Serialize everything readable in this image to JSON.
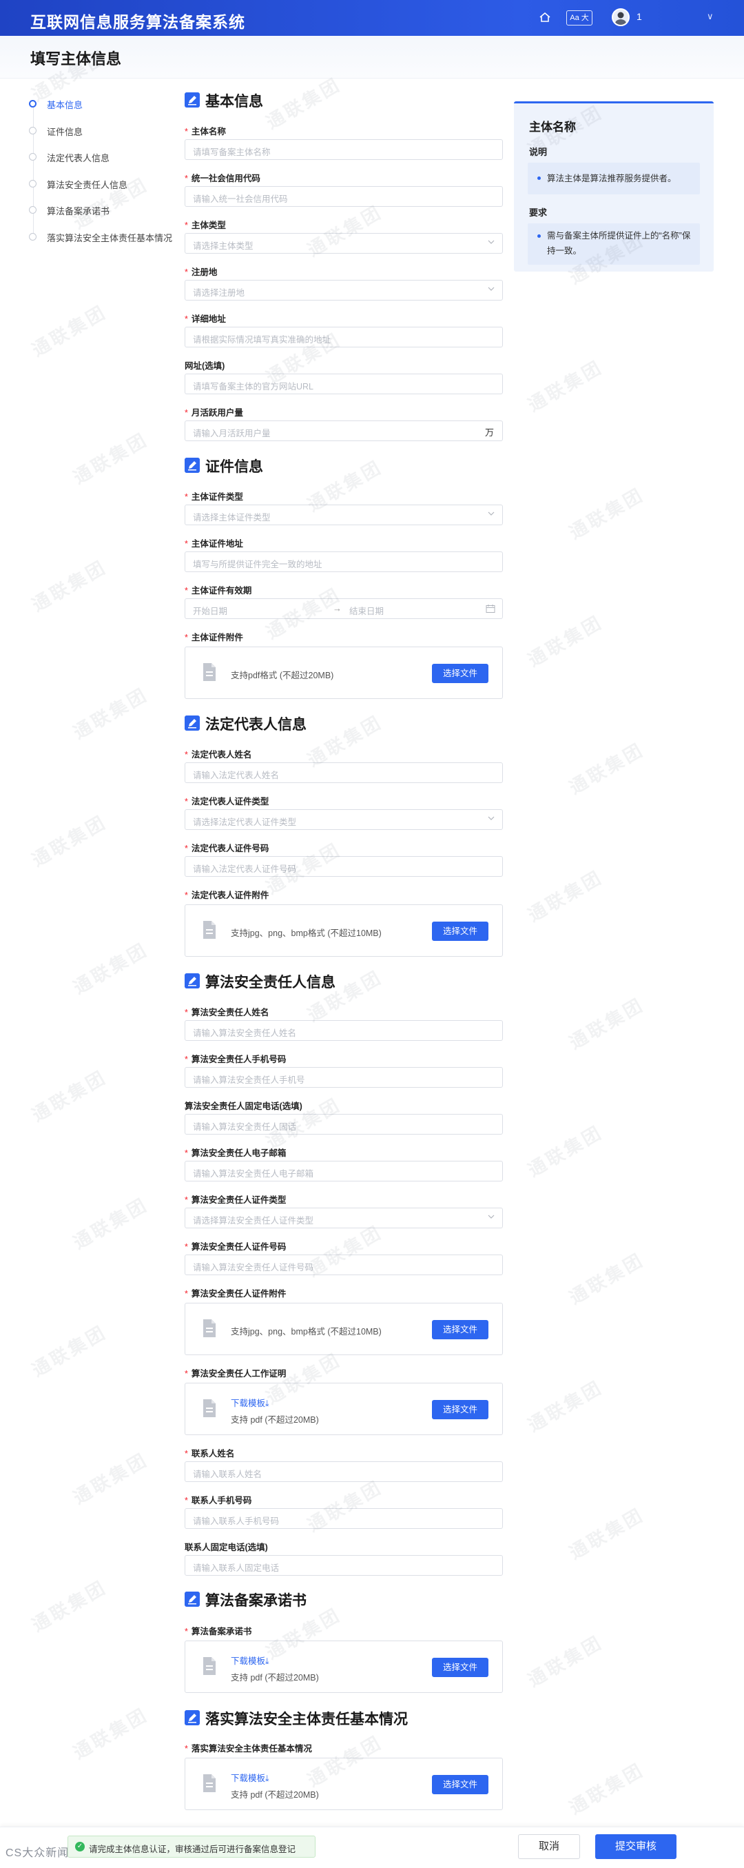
{
  "header": {
    "app_title": "互联网信息服务算法备案系统",
    "font_toggle": "Aa 大",
    "user_name": "1"
  },
  "page_title": "填写主体信息",
  "nav": {
    "items": [
      {
        "label": "基本信息",
        "active": true
      },
      {
        "label": "证件信息",
        "active": false
      },
      {
        "label": "法定代表人信息",
        "active": false
      },
      {
        "label": "算法安全责任人信息",
        "active": false
      },
      {
        "label": "算法备案承诺书",
        "active": false
      },
      {
        "label": "落实算法安全主体责任基本情况",
        "active": false
      }
    ]
  },
  "sections": {
    "basic": "基本信息",
    "cert": "证件信息",
    "legal": "法定代表人信息",
    "safety": "算法安全责任人信息",
    "promise": "算法备案承诺书",
    "duty": "落实算法安全主体责任基本情况"
  },
  "fields": {
    "subject_name": {
      "label": "主体名称",
      "placeholder": "请填写备案主体名称"
    },
    "credit_code": {
      "label": "统一社会信用代码",
      "placeholder": "请输入统一社会信用代码"
    },
    "subject_type": {
      "label": "主体类型",
      "placeholder": "请选择主体类型"
    },
    "region": {
      "label": "注册地",
      "placeholder": "请选择注册地"
    },
    "address": {
      "label": "详细地址",
      "placeholder": "请根据实际情况填写真实准确的地址"
    },
    "website": {
      "label": "网址(选填)",
      "placeholder": "请填写备案主体的官方网站URL"
    },
    "mau": {
      "label": "月活跃用户量",
      "placeholder": "请输入月活跃用户量",
      "suffix": "万"
    },
    "cert_type": {
      "label": "主体证件类型",
      "placeholder": "请选择主体证件类型"
    },
    "cert_address": {
      "label": "主体证件地址",
      "placeholder": "填写与所提供证件完全一致的地址"
    },
    "cert_validity": {
      "label": "主体证件有效期",
      "start_placeholder": "开始日期",
      "end_placeholder": "结束日期",
      "separator": "→"
    },
    "cert_attachment": {
      "label": "主体证件附件",
      "hint": "支持pdf格式 (不超过20MB)",
      "button": "选择文件"
    },
    "legal_name": {
      "label": "法定代表人姓名",
      "placeholder": "请输入法定代表人姓名"
    },
    "legal_id_type": {
      "label": "法定代表人证件类型",
      "placeholder": "请选择法定代表人证件类型"
    },
    "legal_id_no": {
      "label": "法定代表人证件号码",
      "placeholder": "请输入法定代表人证件号码"
    },
    "legal_attachment": {
      "label": "法定代表人证件附件",
      "hint": "支持jpg、png、bmp格式 (不超过10MB)",
      "button": "选择文件"
    },
    "safety_name": {
      "label": "算法安全责任人姓名",
      "placeholder": "请输入算法安全责任人姓名"
    },
    "safety_phone": {
      "label": "算法安全责任人手机号码",
      "placeholder": "请输入算法安全责任人手机号"
    },
    "safety_tel": {
      "label": "算法安全责任人固定电话(选填)",
      "placeholder": "请输入算法安全责任人固话"
    },
    "safety_email": {
      "label": "算法安全责任人电子邮箱",
      "placeholder": "请输入算法安全责任人电子邮箱"
    },
    "safety_id_type": {
      "label": "算法安全责任人证件类型",
      "placeholder": "请选择算法安全责任人证件类型"
    },
    "safety_id_no": {
      "label": "算法安全责任人证件号码",
      "placeholder": "请输入算法安全责任人证件号码"
    },
    "safety_attachment": {
      "label": "算法安全责任人证件附件",
      "hint": "支持jpg、png、bmp格式 (不超过10MB)",
      "button": "选择文件"
    },
    "safety_work_proof": {
      "label": "算法安全责任人工作证明",
      "download": "下载模板⤓",
      "hint": "支持 pdf (不超过20MB)",
      "button": "选择文件"
    },
    "contact_name": {
      "label": "联系人姓名",
      "placeholder": "请输入联系人姓名"
    },
    "contact_phone": {
      "label": "联系人手机号码",
      "placeholder": "请输入联系人手机号码"
    },
    "contact_tel": {
      "label": "联系人固定电话(选填)",
      "placeholder": "请输入联系人固定电话"
    },
    "promise_letter": {
      "label": "算法备案承诺书",
      "download": "下载模板⤓",
      "hint": "支持 pdf (不超过20MB)",
      "button": "选择文件"
    },
    "duty_doc": {
      "label": "落实算法安全主体责任基本情况",
      "download": "下载模板⤓",
      "hint": "支持 pdf (不超过20MB)",
      "button": "选择文件"
    }
  },
  "side_panel": {
    "title": "主体名称",
    "desc_label": "说明",
    "desc_text": "算法主体是算法推荐服务提供者。",
    "req_label": "要求",
    "req_text": "需与备案主体所提供证件上的“名称”保持一致。"
  },
  "bottom": {
    "notice": "请完成主体信息认证，审核通过后可进行备案信息登记",
    "cancel": "取消",
    "submit": "提交审核",
    "watermark": "CS大众新闻"
  },
  "watermark_text": "通联集团"
}
